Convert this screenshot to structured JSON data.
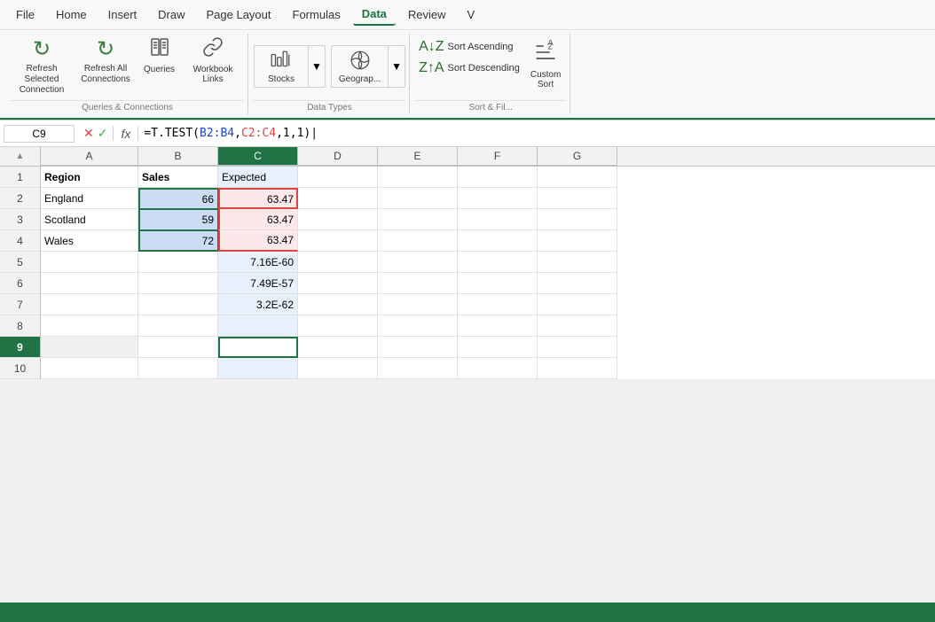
{
  "menu": {
    "items": [
      "File",
      "Home",
      "Insert",
      "Draw",
      "Page Layout",
      "Formulas",
      "Data",
      "Review",
      "V"
    ],
    "active": "Data"
  },
  "ribbon": {
    "groups": [
      {
        "name": "queries-connections",
        "label": "Queries & Connections",
        "buttons": [
          {
            "id": "refresh-selected",
            "icon": "↻",
            "label": "Refresh Selected\nConnection"
          },
          {
            "id": "refresh-all",
            "icon": "↻",
            "label": "Refresh All\nConnections"
          },
          {
            "id": "queries",
            "icon": "≡",
            "label": "Queries"
          },
          {
            "id": "workbook-links",
            "icon": "🔗",
            "label": "Workbook\nLinks"
          }
        ]
      },
      {
        "name": "data-types",
        "label": "Data Types",
        "buttons": [
          {
            "id": "stocks",
            "icon": "🏛",
            "label": "Stocks"
          },
          {
            "id": "geography",
            "icon": "🗺",
            "label": "Geograp..."
          }
        ]
      },
      {
        "name": "sort-filter",
        "label": "Sort & Fil...",
        "sort_asc": "Sort Ascending",
        "sort_desc": "Sort Descending",
        "custom_label": "Custom\nSort"
      }
    ]
  },
  "formula_bar": {
    "cell_ref": "C9",
    "cancel_label": "✕",
    "confirm_label": "✓",
    "fx_label": "fx",
    "formula": "=T.TEST(B2:B4, C2:C4,1,1)"
  },
  "columns": [
    "A",
    "B",
    "C",
    "D",
    "E",
    "F",
    "G"
  ],
  "rows": [
    {
      "row": 1,
      "cells": {
        "A": "Region",
        "B": "Sales",
        "C": "Expected",
        "D": "",
        "E": "",
        "F": "",
        "G": ""
      }
    },
    {
      "row": 2,
      "cells": {
        "A": "England",
        "B": "66",
        "C": "63.47",
        "D": "",
        "E": "",
        "F": "",
        "G": ""
      }
    },
    {
      "row": 3,
      "cells": {
        "A": "Scotland",
        "B": "59",
        "C": "63.47",
        "D": "",
        "E": "",
        "F": "",
        "G": ""
      }
    },
    {
      "row": 4,
      "cells": {
        "A": "Wales",
        "B": "72",
        "C": "63.47",
        "D": "",
        "E": "",
        "F": "",
        "G": ""
      }
    },
    {
      "row": 5,
      "cells": {
        "A": "",
        "B": "",
        "C": "7.16E-60",
        "D": "",
        "E": "",
        "F": "",
        "G": ""
      }
    },
    {
      "row": 6,
      "cells": {
        "A": "",
        "B": "",
        "C": "7.49E-57",
        "D": "",
        "E": "",
        "F": "",
        "G": ""
      }
    },
    {
      "row": 7,
      "cells": {
        "A": "",
        "B": "",
        "C": "3.2E-62",
        "D": "",
        "E": "",
        "F": "",
        "G": ""
      }
    },
    {
      "row": 8,
      "cells": {
        "A": "",
        "B": "",
        "C": "",
        "D": "",
        "E": "",
        "F": "",
        "G": ""
      }
    },
    {
      "row": 9,
      "cells": {
        "A": "",
        "B": "",
        "C": "",
        "D": "",
        "E": "",
        "F": "",
        "G": ""
      }
    },
    {
      "row": 10,
      "cells": {
        "A": "",
        "B": "",
        "C": "",
        "D": "",
        "E": "",
        "F": "",
        "G": ""
      }
    }
  ],
  "cell9_tooltip": "=T.TEST(B2:B4, C2:C4,1,1)",
  "status_bar": {
    "text": ""
  }
}
